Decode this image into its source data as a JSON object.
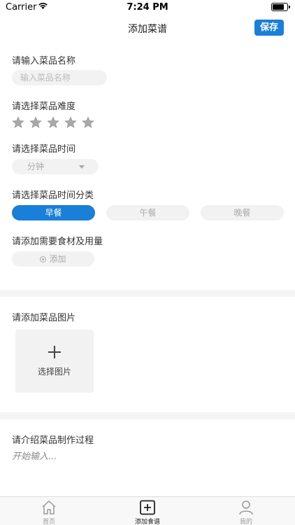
{
  "status_bar": {
    "carrier": "Carrier",
    "time": "7:24 PM",
    "battery_level": 0.85
  },
  "nav": {
    "title": "添加菜谱",
    "save_label": "保存"
  },
  "form": {
    "name_label": "请输入菜品名称",
    "name_placeholder": "输入菜品名称",
    "difficulty_label": "请选择菜品难度",
    "difficulty_rating": 0,
    "difficulty_max": 5,
    "time_label": "请选择菜品时间",
    "time_value": "分钟",
    "category_label": "请选择菜品时间分类",
    "categories": [
      {
        "label": "早餐",
        "selected": true
      },
      {
        "label": "午餐",
        "selected": false
      },
      {
        "label": "晚餐",
        "selected": false
      }
    ],
    "ingredients_label": "请添加需要食材及用量",
    "add_label": "添加",
    "image_label": "请添加菜品图片",
    "image_button": "选择图片",
    "process_label": "请介绍菜品制作过程",
    "process_placeholder": "开始输入..."
  },
  "tabs": [
    {
      "label": "首页",
      "icon": "home-icon",
      "active": false
    },
    {
      "label": "添加食谱",
      "icon": "add-recipe-icon",
      "active": true
    },
    {
      "label": "我的",
      "icon": "profile-icon",
      "active": false
    }
  ],
  "colors": {
    "accent": "#1a7fd8",
    "pill_bg": "#f2f2f2",
    "divider": "#f4f4f4"
  }
}
